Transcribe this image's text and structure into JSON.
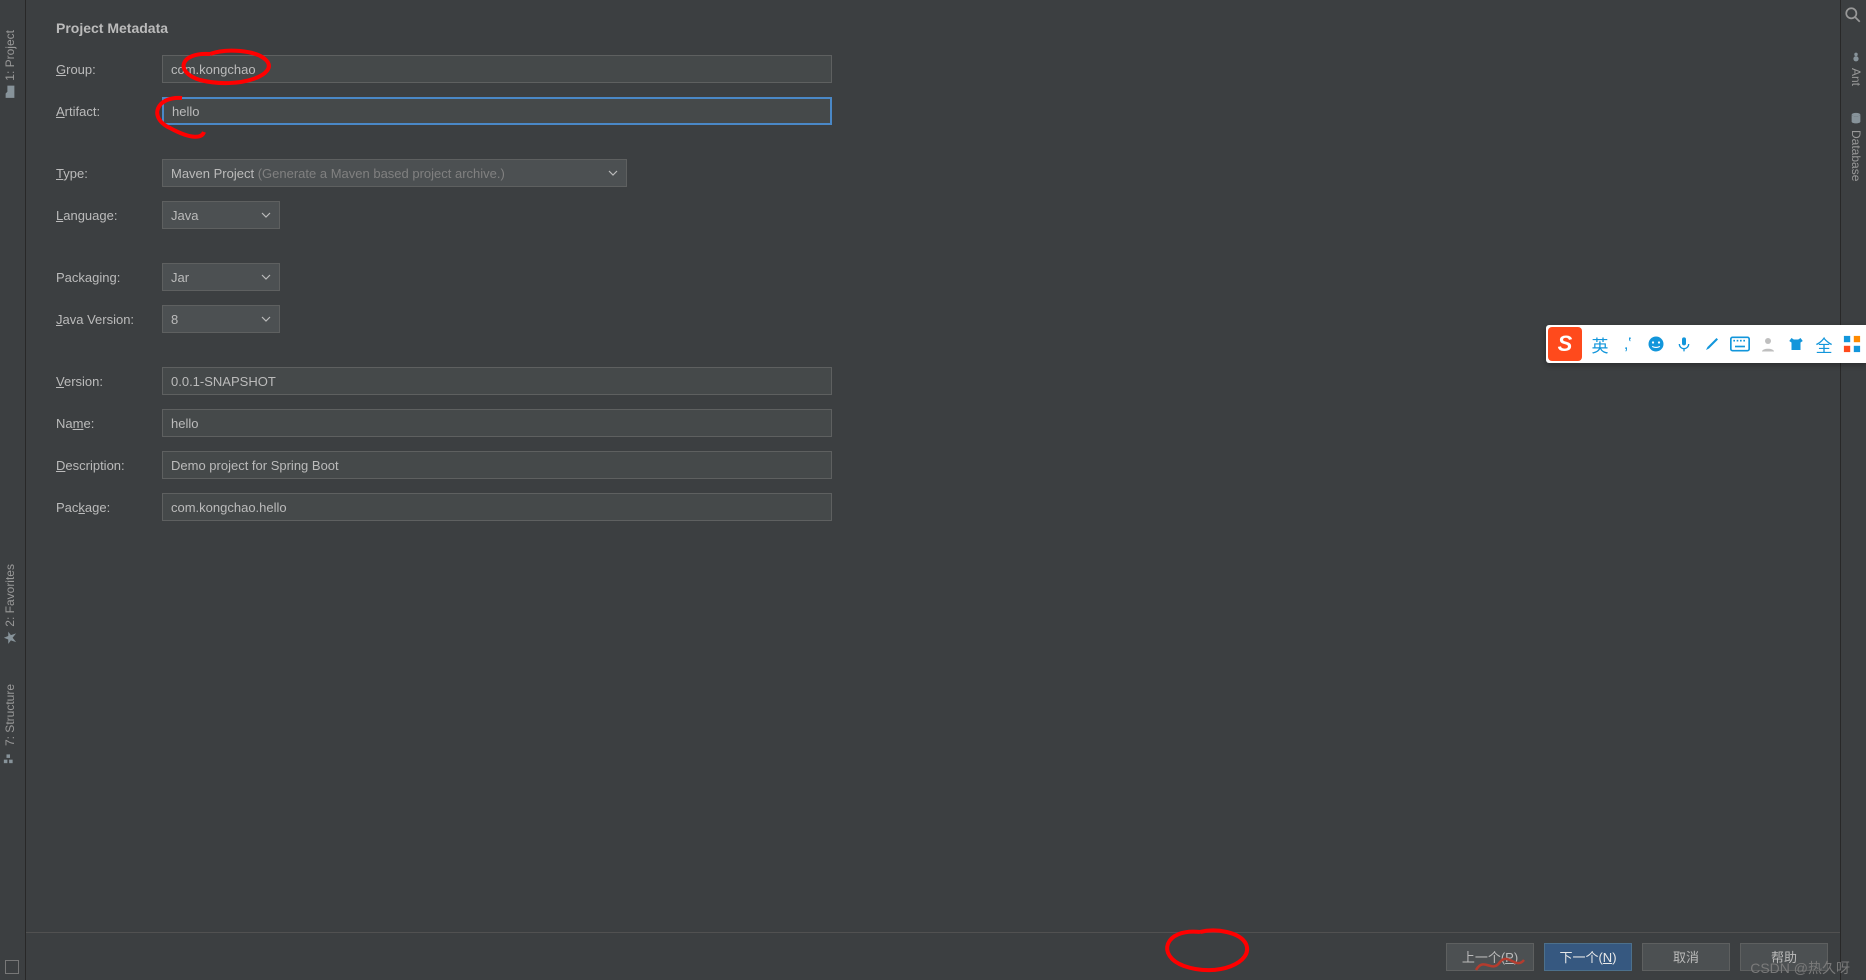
{
  "heading": "Project Metadata",
  "fields": {
    "group": {
      "label": "Group:",
      "value": "com.kongchao"
    },
    "artifact": {
      "label": "Artifact:",
      "value": "hello"
    },
    "type": {
      "label": "Type:",
      "value": "Maven Project",
      "hint": "(Generate a Maven based project archive.)"
    },
    "language": {
      "label": "Language:",
      "value": "Java"
    },
    "packaging": {
      "label": "Packaging:",
      "value": "Jar"
    },
    "javaVersion": {
      "label": "Java Version:",
      "value": "8"
    },
    "version": {
      "label": "Version:",
      "value": "0.0.1-SNAPSHOT"
    },
    "name": {
      "label": "Name:",
      "value": "hello"
    },
    "description": {
      "label": "Description:",
      "value": "Demo project for Spring Boot"
    },
    "package": {
      "label": "Package:",
      "value": "com.kongchao.hello"
    }
  },
  "sidebars": {
    "left": {
      "project": "1: Project",
      "favorites": "2: Favorites",
      "structure": "7: Structure"
    },
    "right": {
      "ant": "Ant",
      "database": "Database"
    }
  },
  "buttons": {
    "previous": "上一个(P)",
    "next": "下一个(N)",
    "cancel": "取消",
    "help": "帮助"
  },
  "ime": {
    "langChar": "英",
    "fullChar": "全"
  },
  "watermark": "CSDN @热久呀"
}
